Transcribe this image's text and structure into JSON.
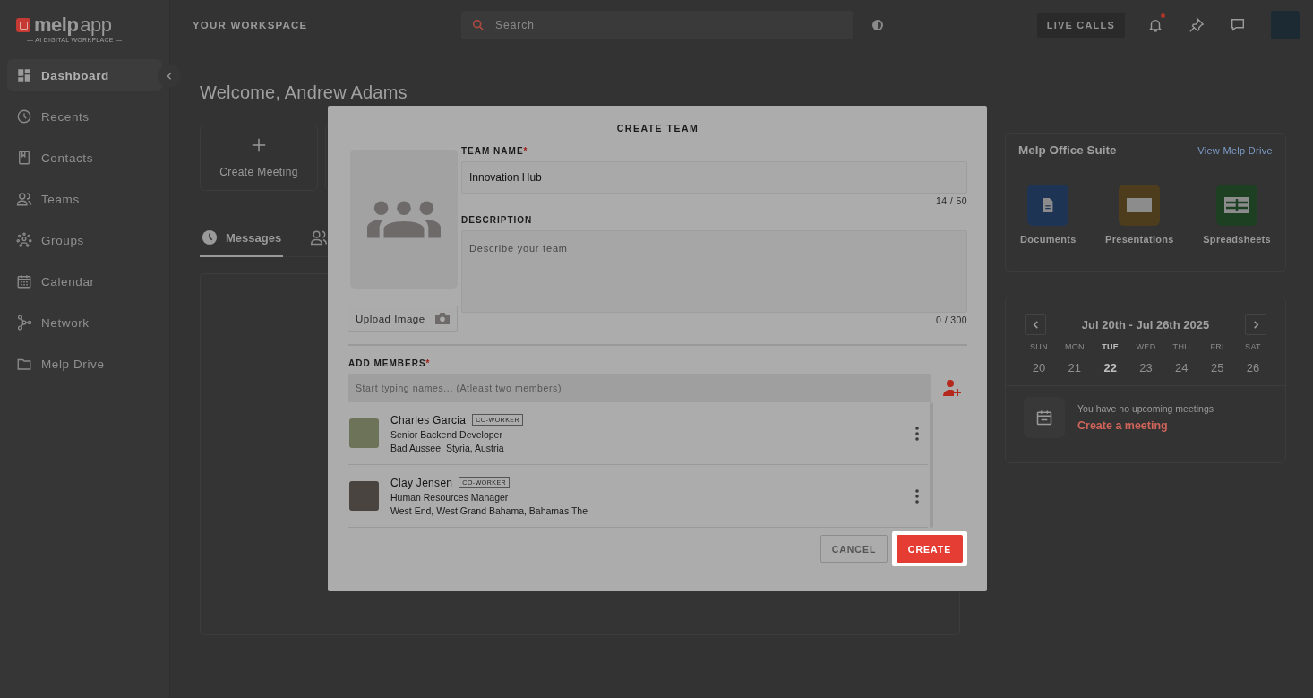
{
  "logo": {
    "name": "melp",
    "suffix": "app",
    "tagline": "— AI DIGITAL WORKPLACE —"
  },
  "sidebar": {
    "items": [
      {
        "kind": "dashboard",
        "label": "Dashboard",
        "selected": true
      },
      {
        "kind": "clock",
        "label": "Recents",
        "selected": false
      },
      {
        "kind": "book",
        "label": "Contacts",
        "selected": false
      },
      {
        "kind": "people",
        "label": "Teams",
        "selected": false
      },
      {
        "kind": "groups",
        "label": "Groups",
        "selected": false
      },
      {
        "kind": "calendar",
        "label": "Calendar",
        "selected": false
      },
      {
        "kind": "network",
        "label": "Network",
        "selected": false
      },
      {
        "kind": "folder",
        "label": "Melp Drive",
        "selected": false
      }
    ]
  },
  "topbar": {
    "workspace": "YOUR WORKSPACE",
    "search": {
      "placeholder": "Search"
    },
    "live_calls": "LIVE CALLS",
    "notification_dot": true
  },
  "main": {
    "welcome": "Welcome, Andrew Adams",
    "actions": [
      {
        "label": "Create Meeting"
      }
    ],
    "tabs": [
      {
        "kind": "clock",
        "label": "Messages",
        "selected": true
      },
      {
        "kind": "people",
        "selected": false
      }
    ]
  },
  "office_suite": {
    "title": "Melp Office Suite",
    "link": "View Melp Drive",
    "apps": [
      {
        "kind": "document",
        "label": "Documents",
        "color": "#1e3454"
      },
      {
        "kind": "slides",
        "label": "Presentations",
        "color": "#4e3d1c"
      },
      {
        "kind": "sheet",
        "label": "Spreadsheets",
        "color": "#1d3f22"
      }
    ]
  },
  "calendar": {
    "range": "Jul 20th - Jul 26th 2025",
    "days": [
      {
        "weekday": "SUN",
        "date": "20",
        "selected": false
      },
      {
        "weekday": "MON",
        "date": "21",
        "selected": false
      },
      {
        "weekday": "TUE",
        "date": "22",
        "selected": true
      },
      {
        "weekday": "WED",
        "date": "23",
        "selected": false
      },
      {
        "weekday": "THU",
        "date": "24",
        "selected": false
      },
      {
        "weekday": "FRI",
        "date": "25",
        "selected": false
      },
      {
        "weekday": "SAT",
        "date": "26",
        "selected": false
      }
    ],
    "empty_text": "You have no upcoming meetings",
    "create_link": "Create a meeting"
  },
  "dialog": {
    "title": "CREATE TEAM",
    "required_mark": "*",
    "team_name": {
      "label": "TEAM NAME",
      "required": true,
      "value": "Innovation Hub",
      "count": "14 / 50"
    },
    "description": {
      "label": "DESCRIPTION",
      "required": false,
      "placeholder": "Describe your team",
      "count": "0 / 300"
    },
    "upload": "Upload Image",
    "members": {
      "label": "ADD MEMBERS",
      "required": true,
      "placeholder": "Start typing names... (Atleast two members)",
      "list": [
        {
          "name": "Charles Garcia",
          "tag": "CO-WORKER",
          "title": "Senior Backend Developer",
          "location": "Bad Aussee, Styria, Austria",
          "color": "#6d7358"
        },
        {
          "name": "Clay Jensen",
          "tag": "CO-WORKER",
          "title": "Human Resources Manager",
          "location": "West End, West Grand Bahama, Bahamas The",
          "color": "#4a4440"
        }
      ]
    },
    "buttons": [
      {
        "kind": "cancel",
        "label": "CANCEL"
      },
      {
        "kind": "primary",
        "label": "CREATE",
        "highlighted": true
      }
    ]
  }
}
